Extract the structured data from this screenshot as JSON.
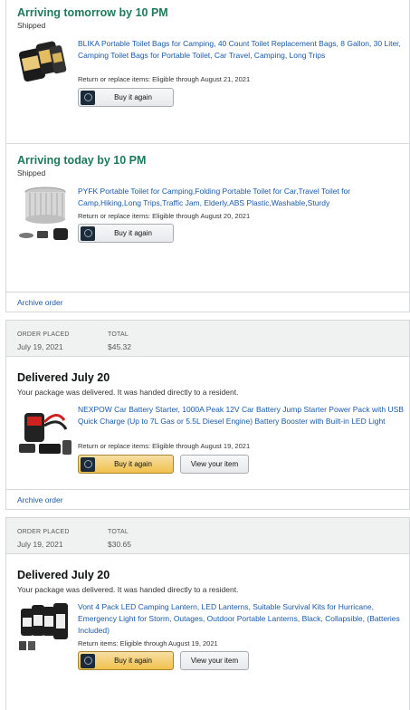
{
  "order_a": {
    "shipments": [
      {
        "status": "Arriving tomorrow by 10 PM",
        "substatus": "Shipped",
        "item_title": "BLIKA Portable Toilet Bags for Camping, 40 Count Toilet Replacement Bags, 8 Gallon, 30 Liter, Camping Toilet Bags for Portable Toilet, Car Travel, Camping, Long Trips",
        "return_note": "Return or replace items: Eligible through August 21, 2021",
        "buy_again_label": "Buy it again"
      },
      {
        "status": "Arriving today by 10 PM",
        "substatus": "Shipped",
        "item_title": "PYFK Portable Toilet for Camping,Folding Portable Toilet for Car,Travel Toilet for Camp,Hiking,Long Trips,Traffic Jam, Elderly,ABS Plastic,Washable,Sturdy",
        "return_note": "Return or replace items: Eligible through August 20, 2021",
        "buy_again_label": "Buy it again"
      }
    ],
    "archive_label": "Archive order"
  },
  "order_b": {
    "placed_label": "ORDER PLACED",
    "placed_value": "July 19, 2021",
    "total_label": "TOTAL",
    "total_value": "$45.32",
    "status": "Delivered July 20",
    "substatus": "Your package was delivered. It was handed directly to a resident.",
    "item_title": "NEXPOW Car Battery Starter, 1000A Peak 12V Car Battery Jump Starter Power Pack with USB Quick Charge (Up to 7L Gas or 5.5L Diesel Engine) Battery Booster with Built-in LED Light",
    "return_note": "Return or replace items: Eligible through August 19, 2021",
    "buy_again_label": "Buy it again",
    "view_item_label": "View your item",
    "archive_label": "Archive order"
  },
  "order_c": {
    "placed_label": "ORDER PLACED",
    "placed_value": "July 19, 2021",
    "total_label": "TOTAL",
    "total_value": "$30.65",
    "status": "Delivered July 20",
    "substatus": "Your package was delivered. It was handed directly to a resident.",
    "item_title": "Vont 4 Pack LED Camping Lantern, LED Lanterns, Suitable Survival Kits for Hurricane, Emergency Light for Storm, Outages, Outdoor Portable Lanterns, Black, Collapsible, (Batteries Included)",
    "return_note": "Return items: Eligible through August 19, 2021",
    "buy_again_label": "Buy it again",
    "view_item_label": "View your item"
  },
  "colors": {
    "arriving_status": "#1f7a5a",
    "link": "#1a5aa6",
    "buy_again_primary": "#f0c14b"
  }
}
